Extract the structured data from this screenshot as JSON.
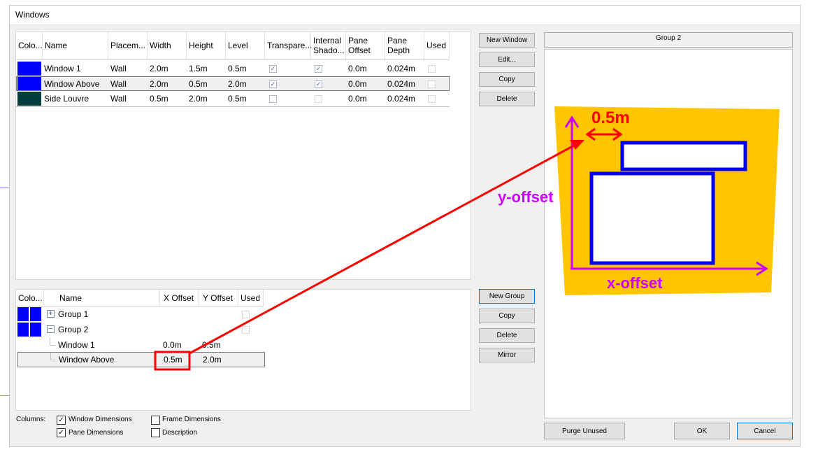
{
  "window": {
    "title": "Windows"
  },
  "windows_table": {
    "headers": {
      "color": "Colo...",
      "name": "Name",
      "placement": "Placem...",
      "width": "Width",
      "height": "Height",
      "level": "Level",
      "transparent": "Transpare...",
      "internal_shading": "Internal Shado...",
      "pane_offset": "Pane Offset",
      "pane_depth": "Pane Depth",
      "used": "Used"
    },
    "rows": [
      {
        "color": "#0000ff",
        "name": "Window 1",
        "placement": "Wall",
        "width": "2.0m",
        "height": "1.5m",
        "level": "0.5m",
        "transparent": true,
        "internal_shading": true,
        "pane_offset": "0.0m",
        "pane_depth": "0.024m",
        "used": false
      },
      {
        "color": "#0000ff",
        "name": "Window Above",
        "placement": "Wall",
        "width": "2.0m",
        "height": "0.5m",
        "level": "2.0m",
        "transparent": true,
        "internal_shading": true,
        "pane_offset": "0.0m",
        "pane_depth": "0.024m",
        "used": false
      },
      {
        "color": "#003d3d",
        "name": "Side Louvre",
        "placement": "Wall",
        "width": "0.5m",
        "height": "2.0m",
        "level": "0.5m",
        "transparent": false,
        "internal_shading": false,
        "pane_offset": "0.0m",
        "pane_depth": "0.024m",
        "used": false
      }
    ]
  },
  "window_buttons": {
    "new": "New Window",
    "edit": "Edit...",
    "copy": "Copy",
    "delete": "Delete"
  },
  "groups_table": {
    "headers": {
      "color": "Colo...",
      "name": "Name",
      "x_offset": "X Offset",
      "y_offset": "Y Offset",
      "used": "Used"
    },
    "groups": [
      {
        "name": "Group 1",
        "expanded": false,
        "color": "#0000ff"
      },
      {
        "name": "Group 2",
        "expanded": true,
        "color": "#0000ff",
        "children": [
          {
            "name": "Window 1",
            "x_offset": "0.0m",
            "y_offset": "0.5m"
          },
          {
            "name": "Window Above",
            "x_offset": "0.5m",
            "y_offset": "2.0m"
          }
        ]
      }
    ]
  },
  "group_buttons": {
    "new": "New Group",
    "copy": "Copy",
    "delete": "Delete",
    "mirror": "Mirror"
  },
  "preview": {
    "title": "Group 2",
    "annotation_dimension": "0.5m",
    "annotation_y": "y-offset",
    "annotation_x": "x-offset",
    "colors": {
      "wall": "#ffc600",
      "window_frame": "#0000ee",
      "arrow_red": "#ff0000",
      "arrow_purple": "#cc00ff"
    }
  },
  "columns": {
    "label": "Columns:",
    "options": [
      {
        "label": "Window Dimensions",
        "checked": true
      },
      {
        "label": "Pane Dimensions",
        "checked": true
      },
      {
        "label": "Frame Dimensions",
        "checked": false
      },
      {
        "label": "Description",
        "checked": false
      }
    ]
  },
  "footer_buttons": {
    "purge": "Purge Unused",
    "ok": "OK",
    "cancel": "Cancel"
  },
  "icons": {
    "checkmark": "✓",
    "expand": "+",
    "collapse": "−"
  }
}
